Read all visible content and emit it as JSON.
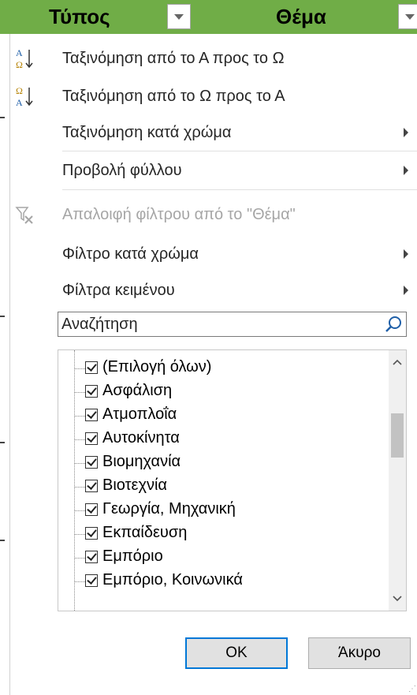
{
  "header": {
    "col1": "Τύπος",
    "col2": "Θέμα",
    "accent": "#70ad47"
  },
  "menu": {
    "sort_az": "Ταξινόμηση από το Α προς το Ω",
    "sort_za": "Ταξινόμηση από το Ω προς το Α",
    "sort_color": "Ταξινόμηση κατά χρώμα",
    "sheet_view": "Προβολή φύλλου",
    "clear_filter": "Απαλοιφή φίλτρου από το \"Θέμα\"",
    "filter_color": "Φίλτρο κατά χρώμα",
    "text_filters": "Φίλτρα κειμένου",
    "icons": [
      "sort-az-icon",
      "sort-za-icon",
      "clear-filter-icon",
      "submenu-arrow-icon"
    ]
  },
  "search": {
    "placeholder": "Αναζήτηση",
    "icon": "search-icon"
  },
  "list": {
    "items": [
      {
        "label": "(Επιλογή όλων)",
        "checked": true
      },
      {
        "label": "Ασφάλιση",
        "checked": true
      },
      {
        "label": "Ατμοπλοΐα",
        "checked": true
      },
      {
        "label": "Αυτοκίνητα",
        "checked": true
      },
      {
        "label": "Βιομηχανία",
        "checked": true
      },
      {
        "label": "Βιοτεχνία",
        "checked": true
      },
      {
        "label": "Γεωργία, Μηχανική",
        "checked": true
      },
      {
        "label": "Εκπαίδευση",
        "checked": true
      },
      {
        "label": "Εμπόριο",
        "checked": true
      },
      {
        "label": "Εμπόριο, Κοινωνικά",
        "checked": true
      }
    ]
  },
  "buttons": {
    "ok": "OK",
    "cancel": "Άκυρο"
  },
  "colors": {
    "ok_border": "#0078d7",
    "disabled_text": "#a6a6a6"
  }
}
